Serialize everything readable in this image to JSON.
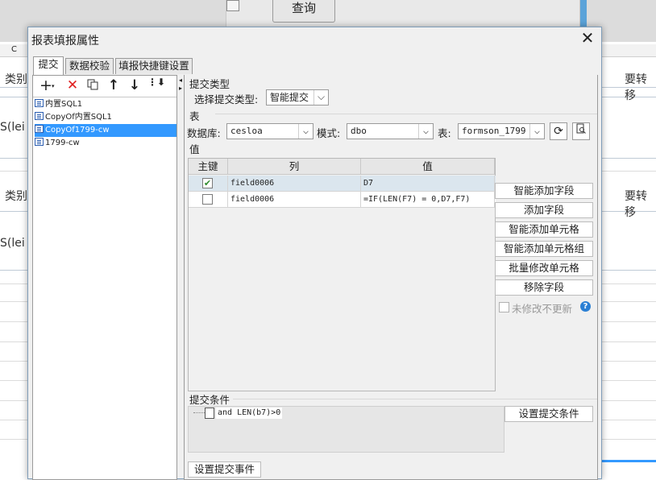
{
  "background": {
    "query_button": "查询",
    "column_header": "C",
    "cells": {
      "category_1": "类别",
      "category_2": "类别",
      "lei_1": "S(lei",
      "lei_2": "S(lei",
      "right_1": "要转移",
      "right_2": "要转移"
    }
  },
  "dialog": {
    "title": "报表填报属性",
    "tabs": [
      "提交",
      "数据校验",
      "填报快捷键设置"
    ],
    "tree_items": [
      "内置SQL1",
      "CopyOf内置SQL1",
      "CopyOf1799-cw",
      "1799-cw"
    ],
    "submit_type_section": "提交类型",
    "submit_type_label": "选择提交类型:",
    "submit_type_value": "智能提交",
    "table_section": "表",
    "database_label": "数据库:",
    "database_value": "cesloa",
    "schema_label": "模式:",
    "schema_value": "dbo",
    "table_label": "表:",
    "table_value": "formson_1799",
    "value_section": "值",
    "grid_headers": [
      "主键",
      "列",
      "值"
    ],
    "rows": [
      {
        "checked": true,
        "column": "field0006",
        "value": "D7"
      },
      {
        "checked": false,
        "column": "field0006",
        "value": "=IF(LEN(F7) = 0,D7,F7)"
      }
    ],
    "side_buttons": [
      "智能添加字段",
      "添加字段",
      "智能添加单元格",
      "智能添加单元格组",
      "批量修改单元格",
      "移除字段"
    ],
    "no_update_label": "未修改不更新",
    "help_icon": "?",
    "condition_section": "提交条件",
    "condition_value": "and LEN(b7)>0",
    "set_condition_button": "设置提交条件",
    "set_event_button": "设置提交事件",
    "accent_color": "#3399ff"
  }
}
